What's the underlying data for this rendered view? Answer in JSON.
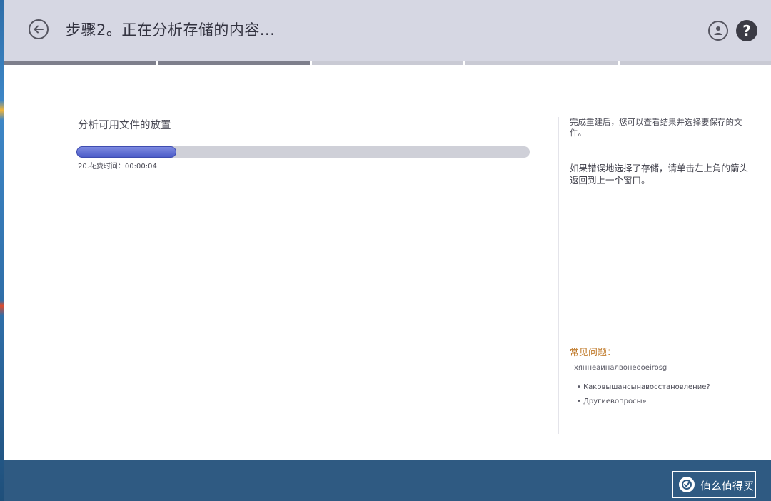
{
  "header": {
    "title": "步骤2。正在分析存储的内容...",
    "back_icon": "arrow-left-icon",
    "account_icon": "user-icon",
    "help_label": "?"
  },
  "steps": {
    "total": 5,
    "completed": 2
  },
  "main": {
    "task_label": "分析可用文件的放置",
    "progress_fraction": 0.22,
    "progress_status": "20.花费时间：00:00:04"
  },
  "sidebar": {
    "note_1": "完成重建后，您可以查看结果并选择要保存的文件。",
    "note_2": "如果错误地选择了存储，请单击左上角的箭头返回到上一个窗口。",
    "faq_title": "常见问题：",
    "faq_subtitle": "хяннеаиналвонеооeirosg",
    "faq_items": [
      "Каковышансынавосстановление?",
      "Другиевопросы»"
    ]
  },
  "footer": {
    "button_text": "值么值得买",
    "accent": "#2f5a82"
  },
  "colors": {
    "header_bg": "#d6d7e3",
    "progress_fill": "#4c5cc8",
    "faq_title": "#c07a2a"
  }
}
